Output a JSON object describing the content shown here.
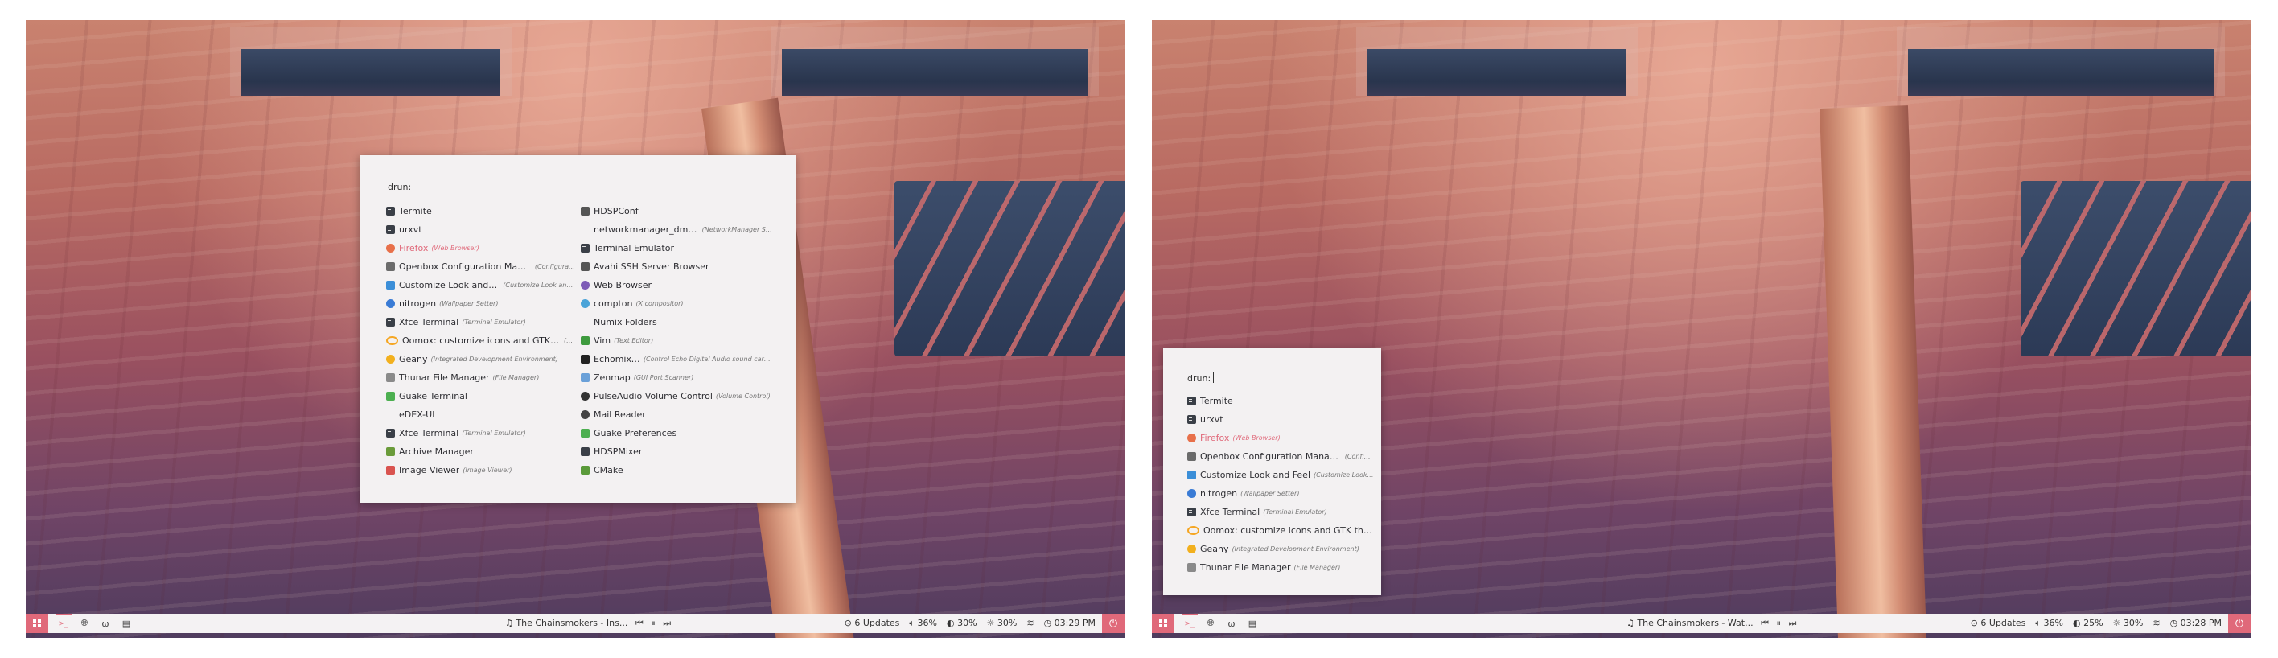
{
  "left": {
    "launcher": {
      "prompt": "drun:",
      "column_a": [
        {
          "label": "Termite",
          "sub": "",
          "icon": "terminal-icon"
        },
        {
          "label": "urxvt",
          "sub": "",
          "icon": "terminal-icon"
        },
        {
          "label": "Firefox",
          "sub": "(Web Browser)",
          "icon": "firefox-icon",
          "selected": true
        },
        {
          "label": "Openbox Configuration Manager",
          "sub": "(Configurati…",
          "icon": "openbox-icon"
        },
        {
          "label": "Customize Look and Feel",
          "sub": "(Customize Look and F…",
          "icon": "appearance-icon"
        },
        {
          "label": "nitrogen",
          "sub": "(Wallpaper Setter)",
          "icon": "nitrogen-icon"
        },
        {
          "label": "Xfce Terminal",
          "sub": "(Terminal Emulator)",
          "icon": "terminal-icon"
        },
        {
          "label": "Oomox: customize icons and GTK themes",
          "sub": "(O…",
          "icon": "oomox-icon"
        },
        {
          "label": "Geany",
          "sub": "(Integrated Development Environment)",
          "icon": "geany-icon"
        },
        {
          "label": "Thunar File Manager",
          "sub": "(File Manager)",
          "icon": "folder-icon"
        },
        {
          "label": "Guake Terminal",
          "sub": "",
          "icon": "guake-icon"
        },
        {
          "label": "eDEX-UI",
          "sub": "",
          "icon": "blank-icon"
        },
        {
          "label": "Xfce Terminal",
          "sub": "(Terminal Emulator)",
          "icon": "terminal-icon"
        },
        {
          "label": "Archive Manager",
          "sub": "",
          "icon": "archive-icon"
        },
        {
          "label": "Image Viewer",
          "sub": "(Image Viewer)",
          "icon": "image-viewer-icon"
        }
      ],
      "column_b": [
        {
          "label": "HDSPConf",
          "sub": "",
          "icon": "tool-icon"
        },
        {
          "label": "networkmanager_dmenu",
          "sub": "(NetworkManager Sel…",
          "icon": "blank-icon"
        },
        {
          "label": "Terminal Emulator",
          "sub": "",
          "icon": "terminal-icon"
        },
        {
          "label": "Avahi SSH Server Browser",
          "sub": "",
          "icon": "ssh-icon"
        },
        {
          "label": "Web Browser",
          "sub": "",
          "icon": "web-browser-icon"
        },
        {
          "label": "compton",
          "sub": "(X compositor)",
          "icon": "compton-icon"
        },
        {
          "label": "Numix Folders",
          "sub": "",
          "icon": "blank-icon"
        },
        {
          "label": "Vim",
          "sub": "(Text Editor)",
          "icon": "vim-icon"
        },
        {
          "label": "Echomixer",
          "sub": "(Control Echo Digital Audio sound cards)",
          "icon": "echomixer-icon"
        },
        {
          "label": "Zenmap",
          "sub": "(GUI Port Scanner)",
          "icon": "zenmap-icon"
        },
        {
          "label": "PulseAudio Volume Control",
          "sub": "(Volume Control)",
          "icon": "pulseaudio-icon"
        },
        {
          "label": "Mail Reader",
          "sub": "",
          "icon": "mail-icon"
        },
        {
          "label": "Guake Preferences",
          "sub": "",
          "icon": "guake-icon"
        },
        {
          "label": "HDSPMixer",
          "sub": "",
          "icon": "mixer-icon"
        },
        {
          "label": "CMake",
          "sub": "",
          "icon": "cmake-icon"
        }
      ]
    },
    "panel": {
      "media": "The Chainsmokers - Ins...",
      "updates": "6 Updates",
      "volume": "36%",
      "brightness": "30%",
      "battery": "30%",
      "clock": "03:29 PM"
    }
  },
  "right": {
    "launcher": {
      "prompt": "drun:",
      "column_a": [
        {
          "label": "Termite",
          "sub": "",
          "icon": "terminal-icon"
        },
        {
          "label": "urxvt",
          "sub": "",
          "icon": "terminal-icon"
        },
        {
          "label": "Firefox",
          "sub": "(Web Browser)",
          "icon": "firefox-icon",
          "selected": true
        },
        {
          "label": "Openbox Configuration Manager",
          "sub": "(Config…",
          "icon": "openbox-icon"
        },
        {
          "label": "Customize Look and Feel",
          "sub": "(Customize Look…",
          "icon": "appearance-icon"
        },
        {
          "label": "nitrogen",
          "sub": "(Wallpaper Setter)",
          "icon": "nitrogen-icon"
        },
        {
          "label": "Xfce Terminal",
          "sub": "(Terminal Emulator)",
          "icon": "terminal-icon"
        },
        {
          "label": "Oomox: customize icons and GTK them…",
          "sub": "",
          "icon": "oomox-icon"
        },
        {
          "label": "Geany",
          "sub": "(Integrated Development Environment)",
          "icon": "geany-icon"
        },
        {
          "label": "Thunar File Manager",
          "sub": "(File Manager)",
          "icon": "folder-icon"
        }
      ]
    },
    "panel": {
      "media": "The Chainsmokers - Wat...",
      "updates": "6 Updates",
      "volume": "36%",
      "brightness": "25%",
      "battery": "30%",
      "clock": "03:28 PM"
    }
  },
  "icon_colors": {
    "terminal-icon": "#3a3f47",
    "firefox-icon": "#e8704a",
    "openbox-icon": "#6b6b6b",
    "appearance-icon": "#3b8ed8",
    "nitrogen-icon": "#3a7bd5",
    "oomox-icon": "#f5a623",
    "geany-icon": "#f2b01e",
    "folder-icon": "#8a8a8a",
    "guake-icon": "#4caf50",
    "archive-icon": "#6a9b3a",
    "image-viewer-icon": "#d9534f",
    "tool-icon": "#555555",
    "ssh-icon": "#555555",
    "web-browser-icon": "#7d5bb6",
    "compton-icon": "#4aa3d8",
    "vim-icon": "#3f9b3f",
    "echomixer-icon": "#222222",
    "zenmap-icon": "#6aa0d8",
    "pulseaudio-icon": "#333333",
    "mail-icon": "#444444",
    "mixer-icon": "#3a3f47",
    "cmake-icon": "#5a9a3a",
    "blank-icon": ""
  },
  "accent": "#e0697a"
}
